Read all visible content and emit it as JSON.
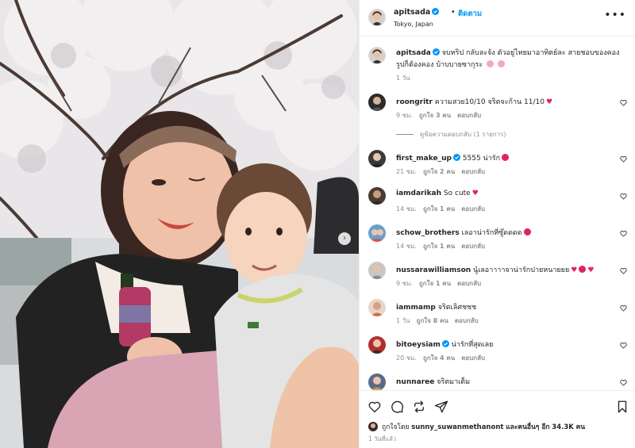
{
  "header": {
    "username": "apitsada",
    "separator": "•",
    "follow_label": "ติดตาม",
    "location": "Tokyo, Japan",
    "more_label": "•••"
  },
  "caption": {
    "username": "apitsada",
    "text": "จบทริป กลับละจ้ง ตัวอยู่ไทยมาอาทิตย์ละ สายชอบของคอง รูปก็ต้องคอง บ้าบบายซากุระ",
    "time": "1 วัน"
  },
  "comments": [
    {
      "username": "roongritr",
      "text": "ความสวย10/10 จริตจะก้าน 11/10",
      "emoji": "heart",
      "time": "9 ชม.",
      "likes": "ถูกใจ 3 คน",
      "reply": "ตอบกลับ",
      "view_replies": "ดูข้อความตอบกลับ (1 รายการ)"
    },
    {
      "username": "first_make_up",
      "verified": true,
      "text": "5555 น่ารัก",
      "emoji": "heart-eyes",
      "time": "21 ชม.",
      "likes": "ถูกใจ 2 คน",
      "reply": "ตอบกลับ"
    },
    {
      "username": "iamdarikah",
      "text": "So cute",
      "emoji": "heart",
      "time": "14 ชม.",
      "likes": "ถูกใจ 1 คน",
      "reply": "ตอบกลับ"
    },
    {
      "username": "schow_brothers",
      "text": "เลอาน่ารักที่ซู๊ดดดด",
      "emoji": "heart-eyes",
      "time": "14 ชม.",
      "likes": "ถูกใจ 1 คน",
      "reply": "ตอบกลับ"
    },
    {
      "username": "nussarawilliamson",
      "text": "นู๋เลอาาาาจาน่ารักปายหนายยย",
      "emoji": "hearts",
      "time": "9 ชม.",
      "likes": "ถูกใจ 1 คน",
      "reply": "ตอบกลับ"
    },
    {
      "username": "iammamp",
      "text": "จริตเลิศชชช",
      "time": "1 วัน",
      "likes": "ถูกใจ 8 คน",
      "reply": "ตอบกลับ"
    },
    {
      "username": "bitoeysiam",
      "verified": true,
      "text": "น่ารักที่สุดเลย",
      "time": "20 ชม.",
      "likes": "ถูกใจ 4 คน",
      "reply": "ตอบกลับ"
    },
    {
      "username": "nunnaree",
      "text": "จริตมาเต็ม"
    }
  ],
  "likes": {
    "prefix": "ถูกใจโดย",
    "liker": "sunny_suwanmethanont",
    "and_others": "และคนอื่นๆ อีก",
    "count": "34.3K",
    "suffix": "คน"
  },
  "post_time": "1 วันที่แล้ว",
  "icons": {
    "like": "heart-outline-icon",
    "comment": "comment-bubble-icon",
    "repost": "repost-icon",
    "share": "paper-plane-icon",
    "save": "bookmark-icon"
  },
  "colors": {
    "link_blue": "#0095f6",
    "verified_blue": "#0095f6",
    "muted_text": "#8e8e8e",
    "heart_red": "#e0245e"
  }
}
